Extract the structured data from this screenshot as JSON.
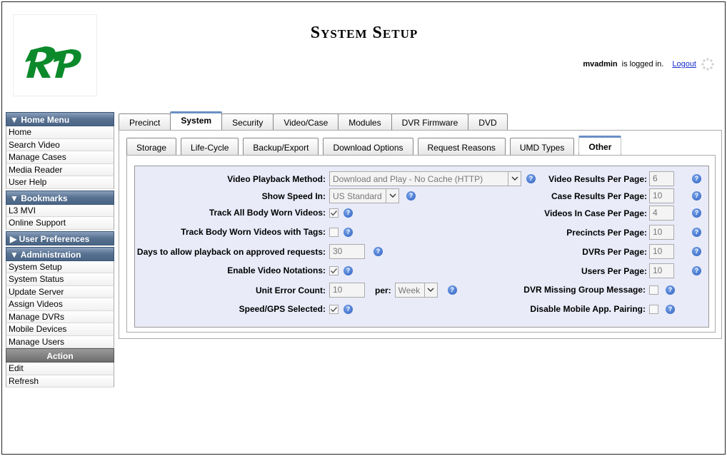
{
  "header": {
    "title": "System Setup",
    "username": "mvadmin",
    "logged_in_text": "is logged in.",
    "logout_label": "Logout"
  },
  "sidebar": {
    "home_menu": {
      "label": "▼ Home Menu",
      "items": [
        "Home",
        "Search Video",
        "Manage Cases",
        "Media Reader",
        "User Help"
      ]
    },
    "bookmarks": {
      "label": "▼ Bookmarks",
      "items": [
        "L3 MVI",
        "Online Support"
      ]
    },
    "user_preferences": {
      "label": "▶ User Preferences"
    },
    "administration": {
      "label": "▼ Administration",
      "items": [
        "System Setup",
        "System Status",
        "Update Server",
        "Assign Videos",
        "Manage DVRs",
        "Mobile Devices",
        "Manage Users"
      ]
    },
    "action": {
      "label": "Action",
      "items": [
        "Edit",
        "Refresh"
      ]
    }
  },
  "tabs_top": [
    "Precinct",
    "System",
    "Security",
    "Video/Case",
    "Modules",
    "DVR Firmware",
    "DVD"
  ],
  "tabs_top_active": "System",
  "tabs_sub": [
    "Storage",
    "Life-Cycle",
    "Backup/Export",
    "Download Options",
    "Request Reasons",
    "UMD Types",
    "Other"
  ],
  "tabs_sub_active": "Other",
  "form": {
    "playback_method": {
      "label": "Video Playback Method:",
      "value": "Download and Play - No Cache (HTTP)"
    },
    "show_speed": {
      "label": "Show Speed In:",
      "value": "US Standard"
    },
    "track_bwv": {
      "label": "Track All Body Worn Videos:",
      "checked": true
    },
    "track_bwv_tags": {
      "label": "Track Body Worn Videos with Tags:",
      "checked": false
    },
    "days_playback": {
      "label": "Days to allow playback on approved requests:",
      "value": "30"
    },
    "video_notations": {
      "label": "Enable Video Notations:",
      "checked": true
    },
    "unit_error": {
      "label": "Unit Error Count:",
      "value": "10",
      "per_label": "per:",
      "per_value": "Week"
    },
    "speed_gps": {
      "label": "Speed/GPS Selected:",
      "checked": true
    },
    "video_results": {
      "label": "Video Results Per Page:",
      "value": "6"
    },
    "case_results": {
      "label": "Case Results Per Page:",
      "value": "10"
    },
    "videos_in_case": {
      "label": "Videos In Case Per Page:",
      "value": "4"
    },
    "precincts": {
      "label": "Precincts Per Page:",
      "value": "10"
    },
    "dvrs": {
      "label": "DVRs Per Page:",
      "value": "10"
    },
    "users": {
      "label": "Users Per Page:",
      "value": "10"
    },
    "dvr_missing": {
      "label": "DVR Missing Group Message:",
      "checked": false
    },
    "disable_mobile": {
      "label": "Disable Mobile App. Pairing:",
      "checked": false
    }
  },
  "help_symbol": "?"
}
